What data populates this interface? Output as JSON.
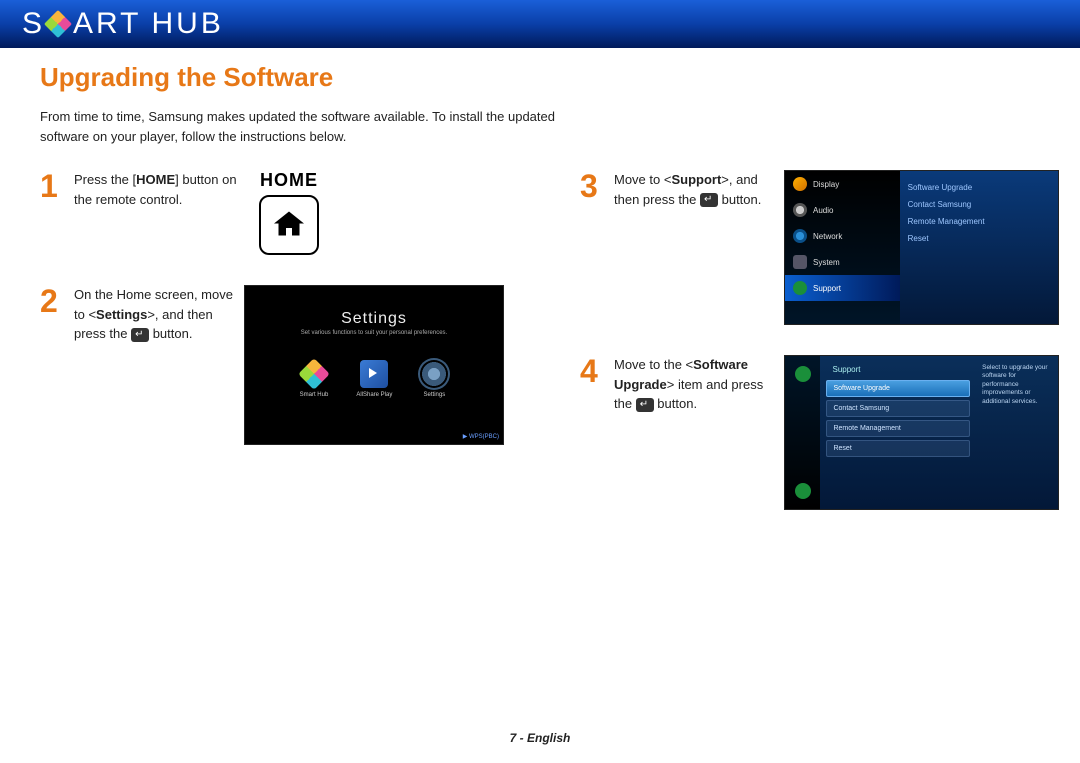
{
  "banner": {
    "brand_a": "S",
    "brand_b": "ART",
    "brand_c": "HUB"
  },
  "title": "Upgrading the Software",
  "intro": "From time to time, Samsung makes updated the software available. To install the updated software on your player, follow the instructions below.",
  "steps": {
    "s1": {
      "num": "1",
      "t1": "Press the [",
      "bold1": "HOME",
      "t2": "] button on the remote control."
    },
    "s2": {
      "num": "2",
      "t1": "On the Home screen, move to <",
      "bold1": "Settings",
      "t2": ">, and then press the ",
      "t3": " button."
    },
    "s3": {
      "num": "3",
      "t1": "Move to <",
      "bold1": "Support",
      "t2": ">, and then press the ",
      "t3": " button."
    },
    "s4": {
      "num": "4",
      "t1": "Move to the <",
      "bold1": "Software Upgrade",
      "t2": "> item and press the ",
      "t3": " button."
    }
  },
  "home_label": "HOME",
  "screen2": {
    "title": "Settings",
    "sub": "Set various functions to suit your personal preferences.",
    "i1": "Smart Hub",
    "i2": "AllShare Play",
    "i3": "Settings",
    "wps": "▶ WPS(PBC)"
  },
  "screen3": {
    "left": [
      "Display",
      "Audio",
      "Network",
      "System",
      "Support"
    ],
    "right": [
      "Software Upgrade",
      "Contact Samsung",
      "Remote Management",
      "Reset"
    ]
  },
  "screen4": {
    "header": "Support",
    "items": [
      "Software Upgrade",
      "Contact Samsung",
      "Remote Management",
      "Reset"
    ],
    "desc": "Select to upgrade your software for performance improvements or additional services."
  },
  "footer": "7 - English"
}
